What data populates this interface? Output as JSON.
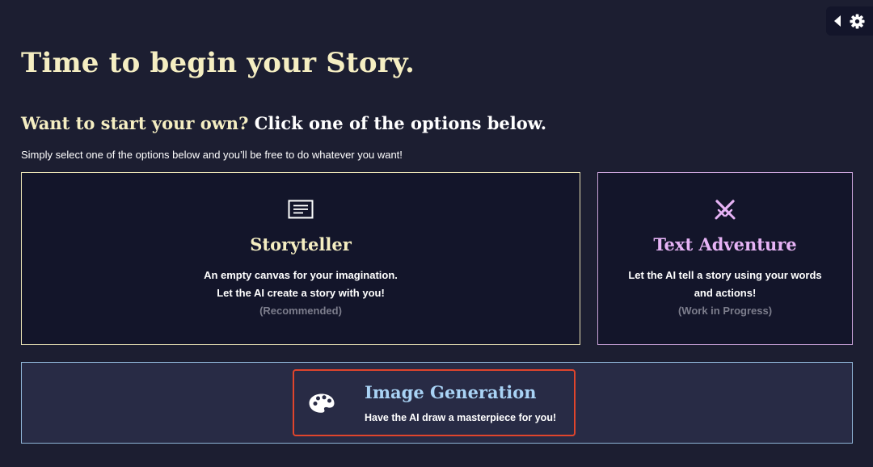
{
  "page": {
    "title": "Time to begin your Story.",
    "subheading_accent": "Want to start your own?",
    "subheading_rest": "Click one of the options below.",
    "intro": "Simply select one of the options below and you’ll be free to do whatever you want!"
  },
  "controls": {
    "collapse_icon": "caret-left-icon",
    "settings_icon": "gear-icon"
  },
  "options": {
    "storyteller": {
      "icon": "document-lines-icon",
      "title": "Storyteller",
      "desc_line1": "An empty canvas for your imagination.",
      "desc_line2": "Let the AI create a story with you!",
      "note": "(Recommended)"
    },
    "text_adventure": {
      "icon": "crossed-swords-icon",
      "title": "Text Adventure",
      "desc_line1": "Let the AI tell a story using your words",
      "desc_line2": "and actions!",
      "note": "(Work in Progress)"
    },
    "image_generation": {
      "icon": "palette-icon",
      "title": "Image Generation",
      "desc": "Have the AI draw a masterpiece for you!"
    }
  },
  "colors": {
    "background": "#1c1e31",
    "card_background": "#13152a",
    "title_cream": "#f5eec2",
    "adventure_purple": "#e6b3f5",
    "image_blue": "#a9d3f5",
    "highlight_red": "#e0452c",
    "muted_note": "#7c7d8c"
  }
}
